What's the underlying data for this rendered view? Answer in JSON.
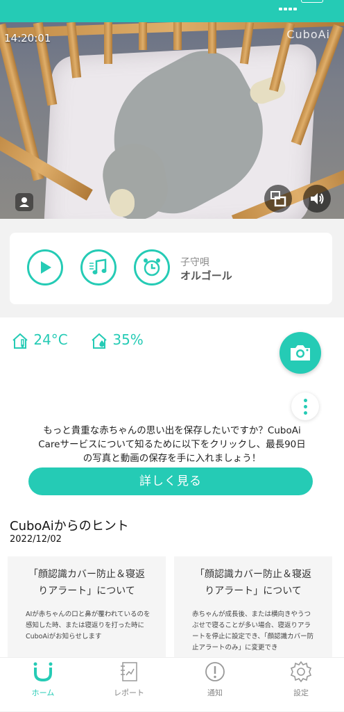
{
  "camera": {
    "timestamp": "14:20:01",
    "brand": "CuboAi"
  },
  "player": {
    "lullaby_label": "子守唄",
    "lullaby_name": "オルゴール"
  },
  "environment": {
    "temperature": "24°C",
    "humidity": "35%"
  },
  "promo": {
    "text_line1": "もっと貴重な赤ちゃんの思い出を保存したいですか？CuboAi",
    "text_line2": "Careサービスについて知るために以下をクリックし、最長90日",
    "text_line3": "の写真と動画の保存を手に入れましょう！",
    "button_label": "詳しく見る"
  },
  "tips": {
    "title": "CuboAiからのヒント",
    "date": "2022/12/02",
    "cards": [
      {
        "title_line1": "「顔認識カバー防止＆寝返",
        "title_line2": "りアラート」について",
        "body": "AIが赤ちゃんの口と鼻が覆われているのを感知した時、または寝返りを打った時にCuboAiがお知らせします"
      },
      {
        "title_line1": "「顔認識カバー防止＆寝返",
        "title_line2": "りアラート」について",
        "body": "赤ちゃんが成長後、または横向きやうつぶせで寝ることが多い場合、寝返りアラートを停止に設定でき、「顔認識カバー防止アラートのみ」に変更でき"
      }
    ]
  },
  "tabbar": {
    "items": [
      {
        "label": "ホーム",
        "icon": "home-icon",
        "active": true
      },
      {
        "label": "レポート",
        "icon": "report-icon",
        "active": false
      },
      {
        "label": "通知",
        "icon": "alert-icon",
        "active": false
      },
      {
        "label": "設定",
        "icon": "gear-icon",
        "active": false
      }
    ]
  },
  "colors": {
    "accent": "#25cbb5"
  }
}
